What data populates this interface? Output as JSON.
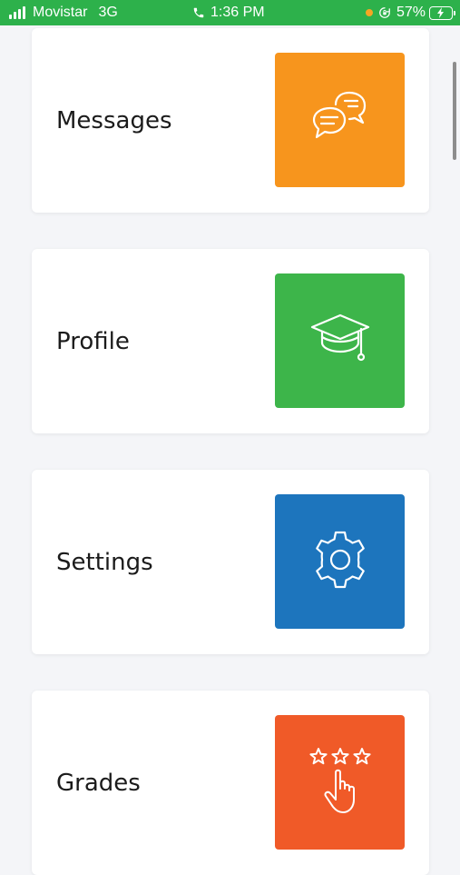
{
  "status_bar": {
    "carrier": "Movistar",
    "network": "3G",
    "time": "1:36 PM",
    "battery": "57%",
    "background_color": "#2db14b"
  },
  "menu": {
    "items": [
      {
        "label": "Messages",
        "icon": "chat-bubbles-icon",
        "color": "#f7951d"
      },
      {
        "label": "Profile",
        "icon": "graduation-cap-icon",
        "color": "#3db54a"
      },
      {
        "label": "Settings",
        "icon": "gear-icon",
        "color": "#1d75bd"
      },
      {
        "label": "Grades",
        "icon": "stars-pointer-icon",
        "color": "#f05a28"
      }
    ]
  }
}
